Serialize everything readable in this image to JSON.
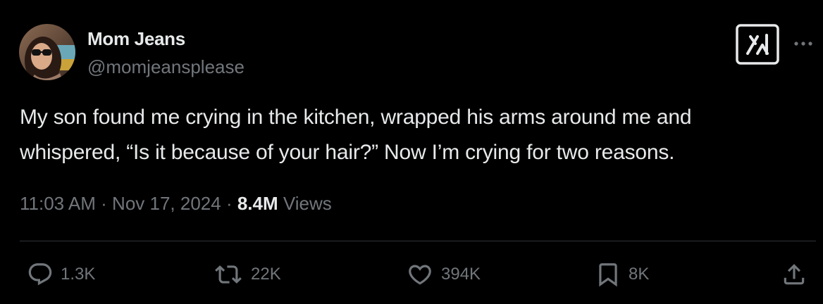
{
  "author": {
    "name": "Mom Jeans",
    "handle": "@momjeansplease"
  },
  "tweet": {
    "line1": "My son found me crying in the kitchen, wrapped his arms around me and",
    "line2": "whispered, “Is it because of your hair?” Now I’m crying for two reasons."
  },
  "meta": {
    "time": "11:03 AM",
    "sep1": " · ",
    "date": "Nov 17, 2024",
    "sep2": " · ",
    "views_count": "8.4M",
    "views_label": " Views"
  },
  "actions": {
    "replies": "1.3K",
    "retweets": "22K",
    "likes": "394K",
    "bookmarks": "8K"
  },
  "colors": {
    "background": "#000000",
    "text_primary": "#e7e9ea",
    "text_secondary": "#71767b",
    "divider": "#2f3336"
  },
  "icons": [
    "grok-icon",
    "more-icon",
    "reply-icon",
    "retweet-icon",
    "heart-icon",
    "bookmark-icon",
    "share-icon"
  ]
}
